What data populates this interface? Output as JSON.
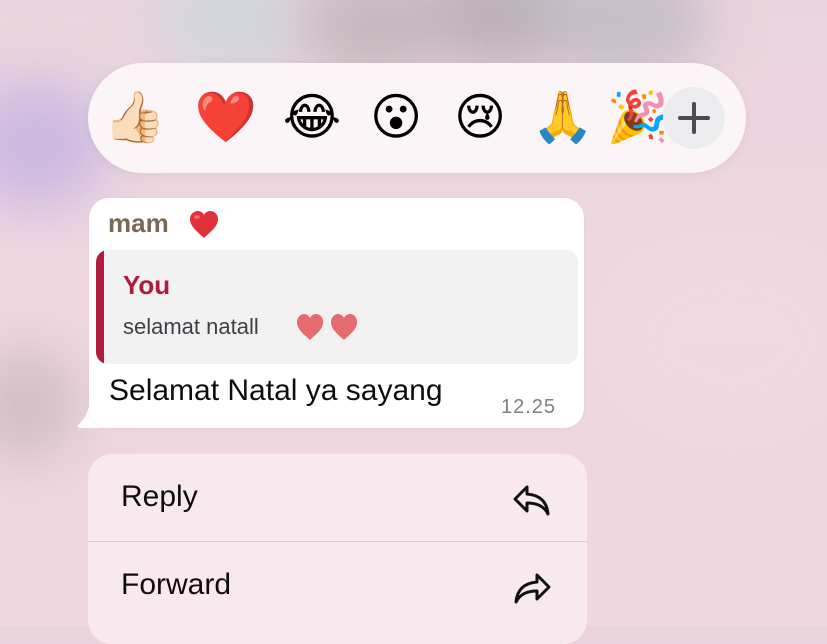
{
  "reactions": {
    "emojis": [
      {
        "name": "thumbs-up",
        "glyph": "👍🏻"
      },
      {
        "name": "red-heart",
        "glyph": "❤️"
      },
      {
        "name": "tears-of-joy",
        "glyph": "😂"
      },
      {
        "name": "astonished",
        "glyph": "😮"
      },
      {
        "name": "crying",
        "glyph": "😢"
      },
      {
        "name": "folded-hands",
        "glyph": "🙏"
      },
      {
        "name": "party-popper",
        "glyph": "🎉"
      }
    ],
    "more_icon": "plus-icon"
  },
  "message": {
    "sender": "mam",
    "sender_emoji": "heart-icon",
    "quote": {
      "author": "You",
      "text": "selamat natall",
      "text_emoji": "two-hearts-icon"
    },
    "text": "Selamat Natal ya sayang",
    "time": "12.25"
  },
  "menu": {
    "reply_label": "Reply",
    "reply_icon": "reply-arrow-icon",
    "forward_label": "Forward",
    "forward_icon": "forward-arrow-icon"
  },
  "colors": {
    "accent": "#b01c3d",
    "sender": "#7a6755",
    "heart": "#e0303a"
  }
}
